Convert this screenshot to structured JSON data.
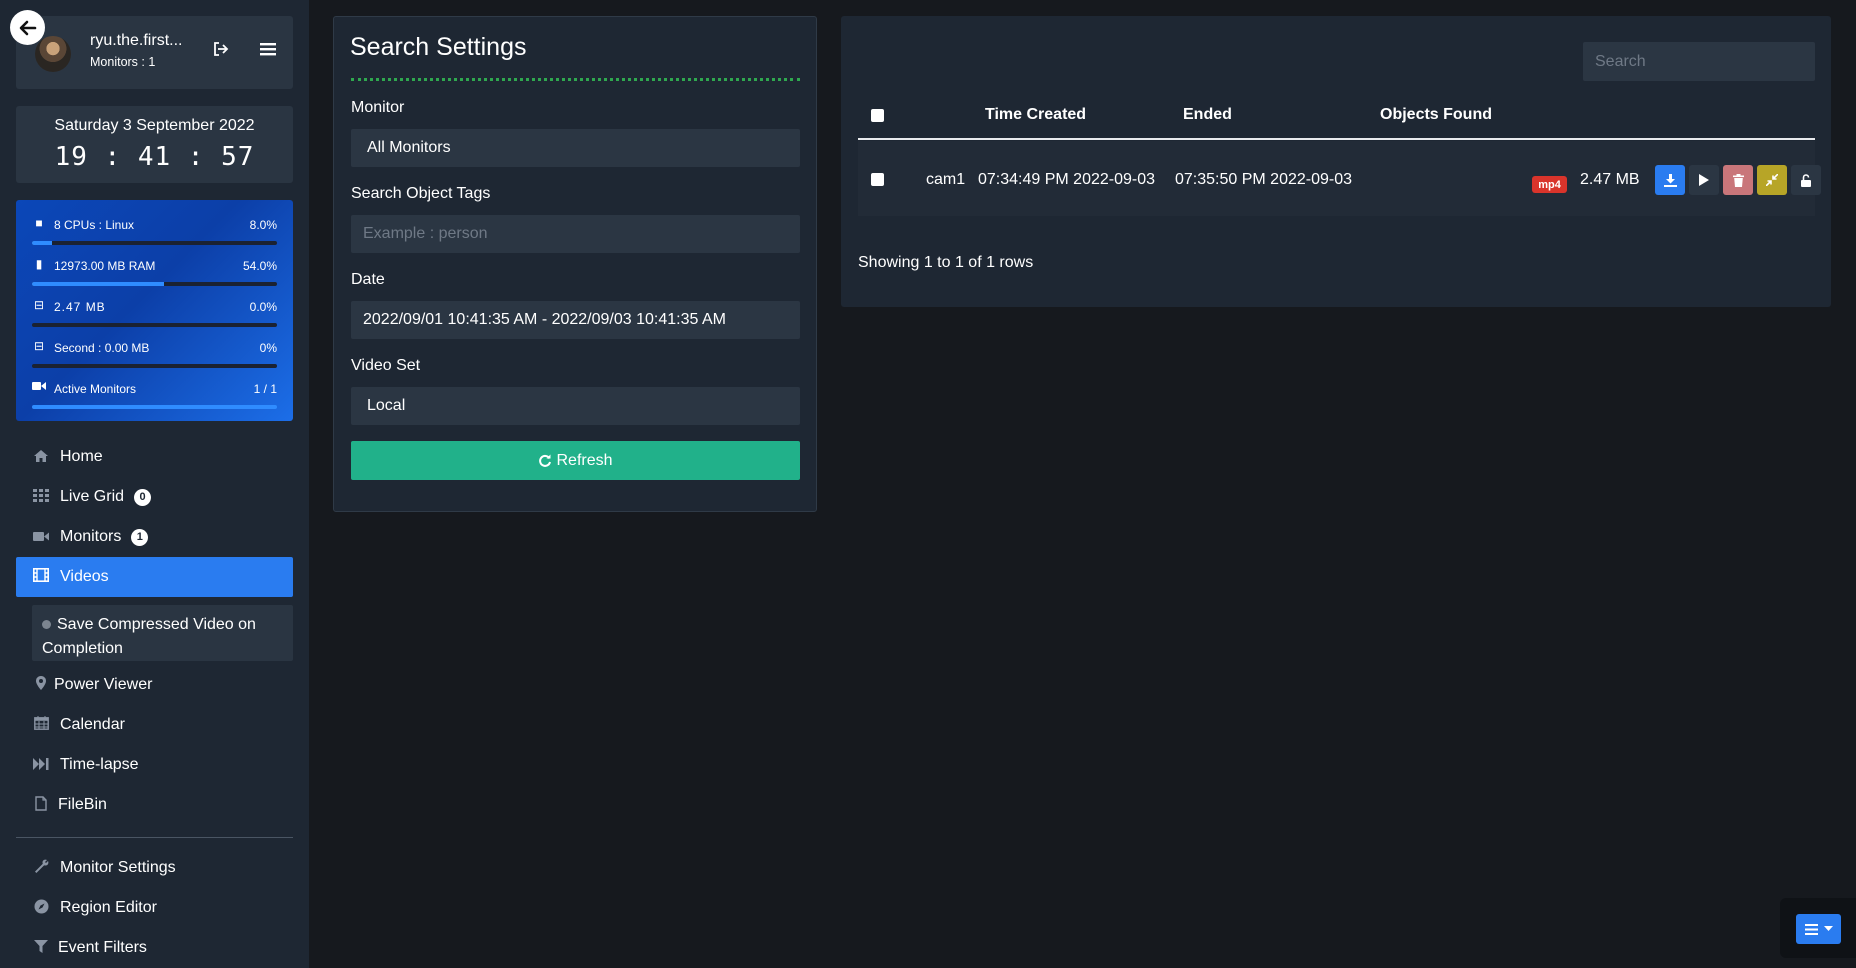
{
  "user": {
    "name": "ryu.the.first...",
    "monitors": "Monitors : 1"
  },
  "clock": {
    "date": "Saturday 3 September 2022",
    "time": "19 : 41 : 57"
  },
  "stats": [
    {
      "icon": "square-icon",
      "glyph": "■",
      "label": "8 CPUs : Linux",
      "value": "8.0%",
      "percent": 8.0
    },
    {
      "icon": "memory-icon",
      "glyph": "▮",
      "label": "12973.00 MB RAM",
      "value": "54.0%",
      "percent": 54.0
    },
    {
      "icon": "hdd-icon",
      "glyph": "⊟",
      "label": "2.47 MB",
      "value": "0.0%",
      "percent": 0.0
    },
    {
      "icon": "hdd-icon",
      "glyph": "⊟",
      "label": "Second : 0.00 MB",
      "value": "0%",
      "percent": 0
    },
    {
      "icon": "video-camera-icon",
      "glyph": "■",
      "label": "Active Monitors",
      "value": "1 / 1",
      "percent": 100
    }
  ],
  "nav": {
    "home": "Home",
    "live_grid": "Live Grid",
    "live_grid_badge": "0",
    "monitors": "Monitors",
    "monitors_badge": "1",
    "videos": "Videos",
    "save_compressed": "Save Compressed Video on Completion",
    "power_viewer": "Power Viewer",
    "calendar": "Calendar",
    "timelapse": "Time-lapse",
    "filebin": "FileBin",
    "monitor_settings": "Monitor Settings",
    "region_editor": "Region Editor",
    "event_filters": "Event Filters"
  },
  "search_settings": {
    "title": "Search Settings",
    "monitor_label": "Monitor",
    "monitor_value": "All Monitors",
    "tags_label": "Search Object Tags",
    "tags_placeholder": "Example : person",
    "date_label": "Date",
    "date_value": "2022/09/01 10:41:35 AM - 2022/09/03 10:41:35 AM",
    "videoset_label": "Video Set",
    "videoset_value": "Local",
    "refresh_label": "Refresh"
  },
  "results": {
    "search_placeholder": "Search",
    "columns": {
      "time_created": "Time Created",
      "ended": "Ended",
      "objects_found": "Objects Found"
    },
    "rows": [
      {
        "monitor": "cam1",
        "time_created": "07:34:49 PM 2022-09-03",
        "ended": "07:35:50 PM 2022-09-03",
        "format": "mp4",
        "size": "2.47 MB"
      }
    ],
    "footer": "Showing 1 to 1 of 1 rows"
  },
  "colors": {
    "accent": "#2a7cf0",
    "refresh": "#21b18a",
    "delete": "#c9767a",
    "compress": "#b7a527",
    "format_badge": "#d9342b"
  }
}
